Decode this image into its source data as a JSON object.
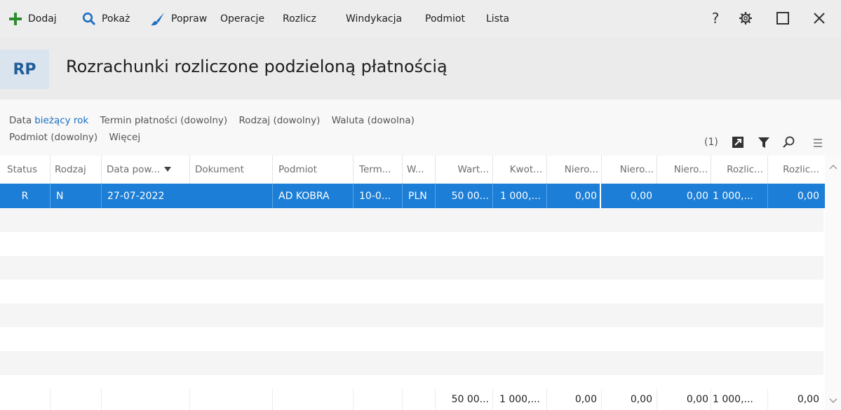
{
  "toolbar": {
    "add_label": "Dodaj",
    "show_label": "Pokaż",
    "edit_label": "Popraw",
    "operations_label": "Operacje",
    "settle_label": "Rozlicz",
    "collection_label": "Windykacja",
    "entity_label": "Podmiot",
    "list_label": "Lista",
    "help_label": "?"
  },
  "header": {
    "badge": "RP",
    "title": "Rozrachunki rozliczone podzieloną płatnością"
  },
  "filters": {
    "date_label": "Data",
    "date_value": "bieżący rok",
    "due_term": "Termin płatności (dowolny)",
    "kind": "Rodzaj (dowolny)",
    "currency": "Waluta (dowolna)",
    "entity": "Podmiot (dowolny)",
    "more": "Więcej",
    "count": "(1)"
  },
  "table": {
    "columns": [
      "Status",
      "Rodzaj",
      "Data pow...",
      "Dokument",
      "Podmiot",
      "Term...",
      "W...",
      "Wart...",
      "Kwot...",
      "Niero...",
      "Niero...",
      "Niero...",
      "Rozlic...",
      "Rozlic..."
    ],
    "rows": [
      [
        "R",
        "N",
        "27-07-2022",
        "",
        "AD KOBRA",
        "10-0...",
        "PLN",
        "50 00...",
        "1 000,...",
        "0,00",
        "0,00",
        "0,00",
        "1 000,...",
        "0,00"
      ]
    ],
    "totals": [
      "",
      "",
      "",
      "",
      "",
      "",
      "",
      "50 00...",
      "1 000,...",
      "0,00",
      "0,00",
      "0,00",
      "1 000,...",
      "0,00"
    ]
  },
  "colors": {
    "accent": "#1c7ed6",
    "add_green": "#2e8b2e",
    "search_blue": "#1f6fc1"
  }
}
